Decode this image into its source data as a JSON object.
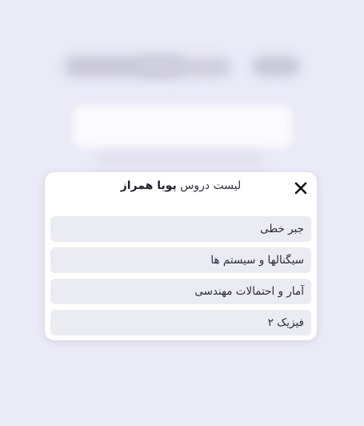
{
  "dialog": {
    "title_prefix": "لیست دروس",
    "title_name": "پویا همراز",
    "close_icon": "close-icon",
    "courses": [
      "جبر خطی",
      "سیگنالها و سیستم ها",
      "آمار و احتمالات مهندسی",
      "فیزیک ۲"
    ]
  },
  "colors": {
    "background": "#ebeaf7",
    "dialog_background": "#ffffff",
    "item_background": "#ebebf3",
    "text": "#2b2b3a"
  }
}
